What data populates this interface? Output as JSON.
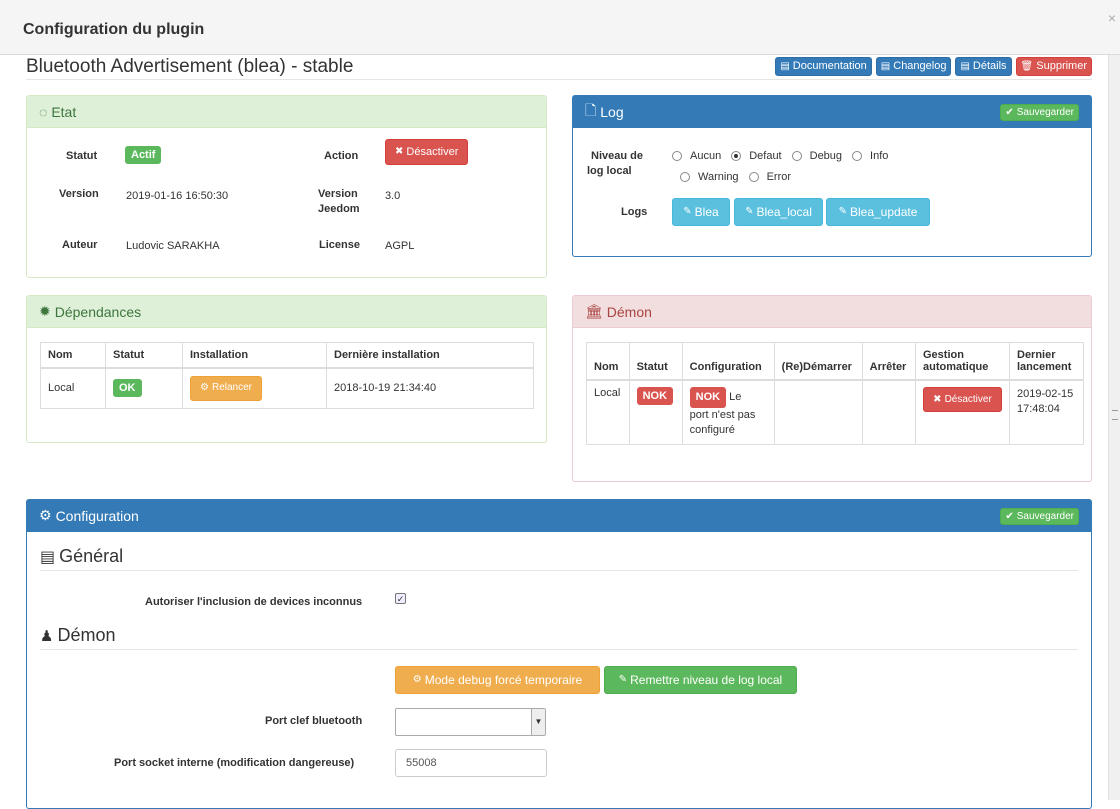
{
  "modal": {
    "title": "Configuration du plugin",
    "close": "×"
  },
  "plugin": {
    "title": "Bluetooth Advertisement (blea) - stable"
  },
  "top_buttons": {
    "documentation": "Documentation",
    "changelog": "Changelog",
    "details": "Détails",
    "delete": "Supprimer"
  },
  "etat": {
    "heading": "Etat",
    "statut_label": "Statut",
    "statut_value": "Actif",
    "action_label": "Action",
    "action_button": "Désactiver",
    "version_label": "Version",
    "version_value": "2019-01-16 16:50:30",
    "jeedom_label_1": "Version",
    "jeedom_label_2": "Jeedom",
    "jeedom_value": "3.0",
    "author_label": "Auteur",
    "author_value": "Ludovic SARAKHA",
    "license_label": "License",
    "license_value": "AGPL"
  },
  "log": {
    "heading": "Log",
    "save_button": "Sauvegarder",
    "level_label_1": "Niveau de",
    "level_label_2": "log local",
    "levels": [
      "Aucun",
      "Defaut",
      "Debug",
      "Info",
      "Warning",
      "Error"
    ],
    "selected_level": "Defaut",
    "logs_label": "Logs",
    "log_buttons": [
      "Blea",
      "Blea_local",
      "Blea_update"
    ]
  },
  "dependances": {
    "heading": "Dépendances",
    "columns": [
      "Nom",
      "Statut",
      "Installation",
      "Dernière installation"
    ],
    "row": {
      "nom": "Local",
      "statut": "OK",
      "installation": "Relancer",
      "derniere": "2018-10-19 21:34:40"
    }
  },
  "demon": {
    "heading": "Démon",
    "columns": [
      "Nom",
      "Statut",
      "Configuration",
      "(Re)Démarrer",
      "Arrêter",
      "Gestion automatique",
      "Dernier lancement"
    ],
    "row": {
      "nom": "Local",
      "statut": "NOK",
      "config_badge": "NOK",
      "config_text_1": "Le",
      "config_text_2": "port n'est pas",
      "config_text_3": "configuré",
      "gestion_button": "Désactiver",
      "dernier_1": "2019-02-15",
      "dernier_2": "17:48:04"
    }
  },
  "configuration": {
    "heading": "Configuration",
    "save_button": "Sauvegarder",
    "general_title": "Général",
    "include_label": "Autoriser l'inclusion de devices inconnus",
    "include_checked": true,
    "demon_title": "Démon",
    "debug_button": "Mode debug forcé temporaire",
    "reset_log_button": "Remettre niveau de log local",
    "port_label": "Port clef bluetooth",
    "port_value": "",
    "socket_label": "Port socket interne (modification dangereuse)",
    "socket_value": "55008"
  },
  "colors": {
    "primary": "#337ab7",
    "success": "#5cb85c",
    "danger": "#d9534f",
    "warning": "#f0ad4e",
    "info": "#5bc0de"
  }
}
